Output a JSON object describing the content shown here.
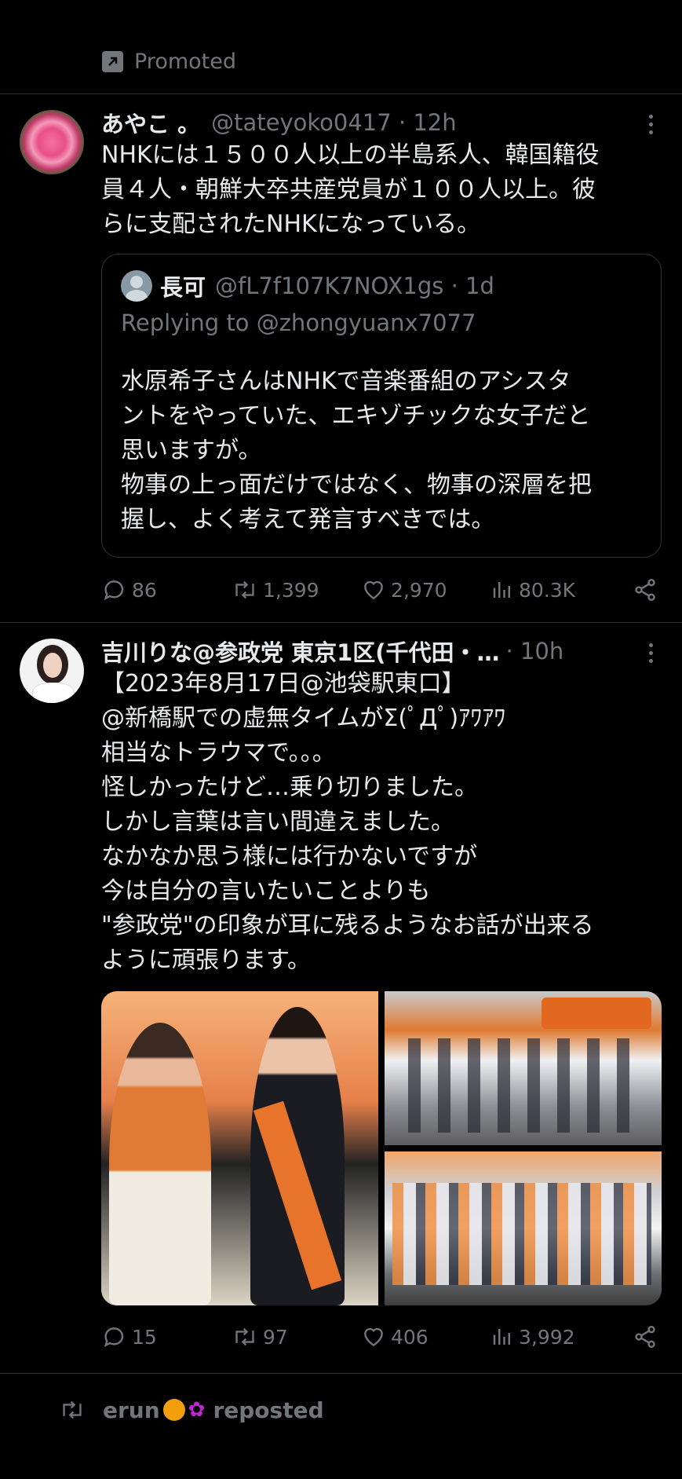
{
  "promoted": {
    "label": "Promoted"
  },
  "tweet1": {
    "name": "あやこ 。",
    "meta": "@tateyoko0417 · 12h",
    "text": "NHKには１５００人以上の半島系人、韓国籍役\n員４人・朝鮮大卒共産党員が１００人以上。彼\nらに支配されたNHKになっている。",
    "quote": {
      "name": "長可",
      "meta": "@fL7f107K7NOX1gs · 1d",
      "replying": "Replying to @zhongyuanx7077",
      "text": "水原希子さんはNHKで音楽番組のアシスタ\nントをやっていた、エキゾチックな女子だと\n思いますが。\n物事の上っ面だけではなく、物事の深層を把\n握し、よく考えて発言すべきでは。"
    },
    "actions": {
      "replies": "86",
      "reposts": "1,399",
      "likes": "2,970",
      "views": "80.3K"
    }
  },
  "tweet2": {
    "name": "吉川りな@参政党 東京1区(千代田・…",
    "meta": "· 10h",
    "text": "【2023年8月17日@池袋駅東口】\n@新橋駅での虚無タイムがΣ(ﾟДﾟ)ｱﾜｱﾜ\n相当なトラウマで。。。\n怪しかったけど…乗り切りました。\nしかし言葉は言い間違えました。\nなかなか思う様には行かないですが\n今は自分の言いたいことよりも\n\"参政党\"の印象が耳に残るようなお話が出来る\nように頑張ります。",
    "actions": {
      "replies": "15",
      "reposts": "97",
      "likes": "406",
      "views": "3,992"
    }
  },
  "repost_banner": {
    "user": "erun",
    "suffix": "reposted"
  },
  "colors": {
    "background": "#000000",
    "text": "#e7e9ea",
    "muted": "#71767b",
    "divider": "#2f3336"
  },
  "icons": [
    "promoted-icon",
    "more-icon",
    "reply-icon",
    "retweet-icon",
    "like-icon",
    "views-icon",
    "share-icon"
  ]
}
